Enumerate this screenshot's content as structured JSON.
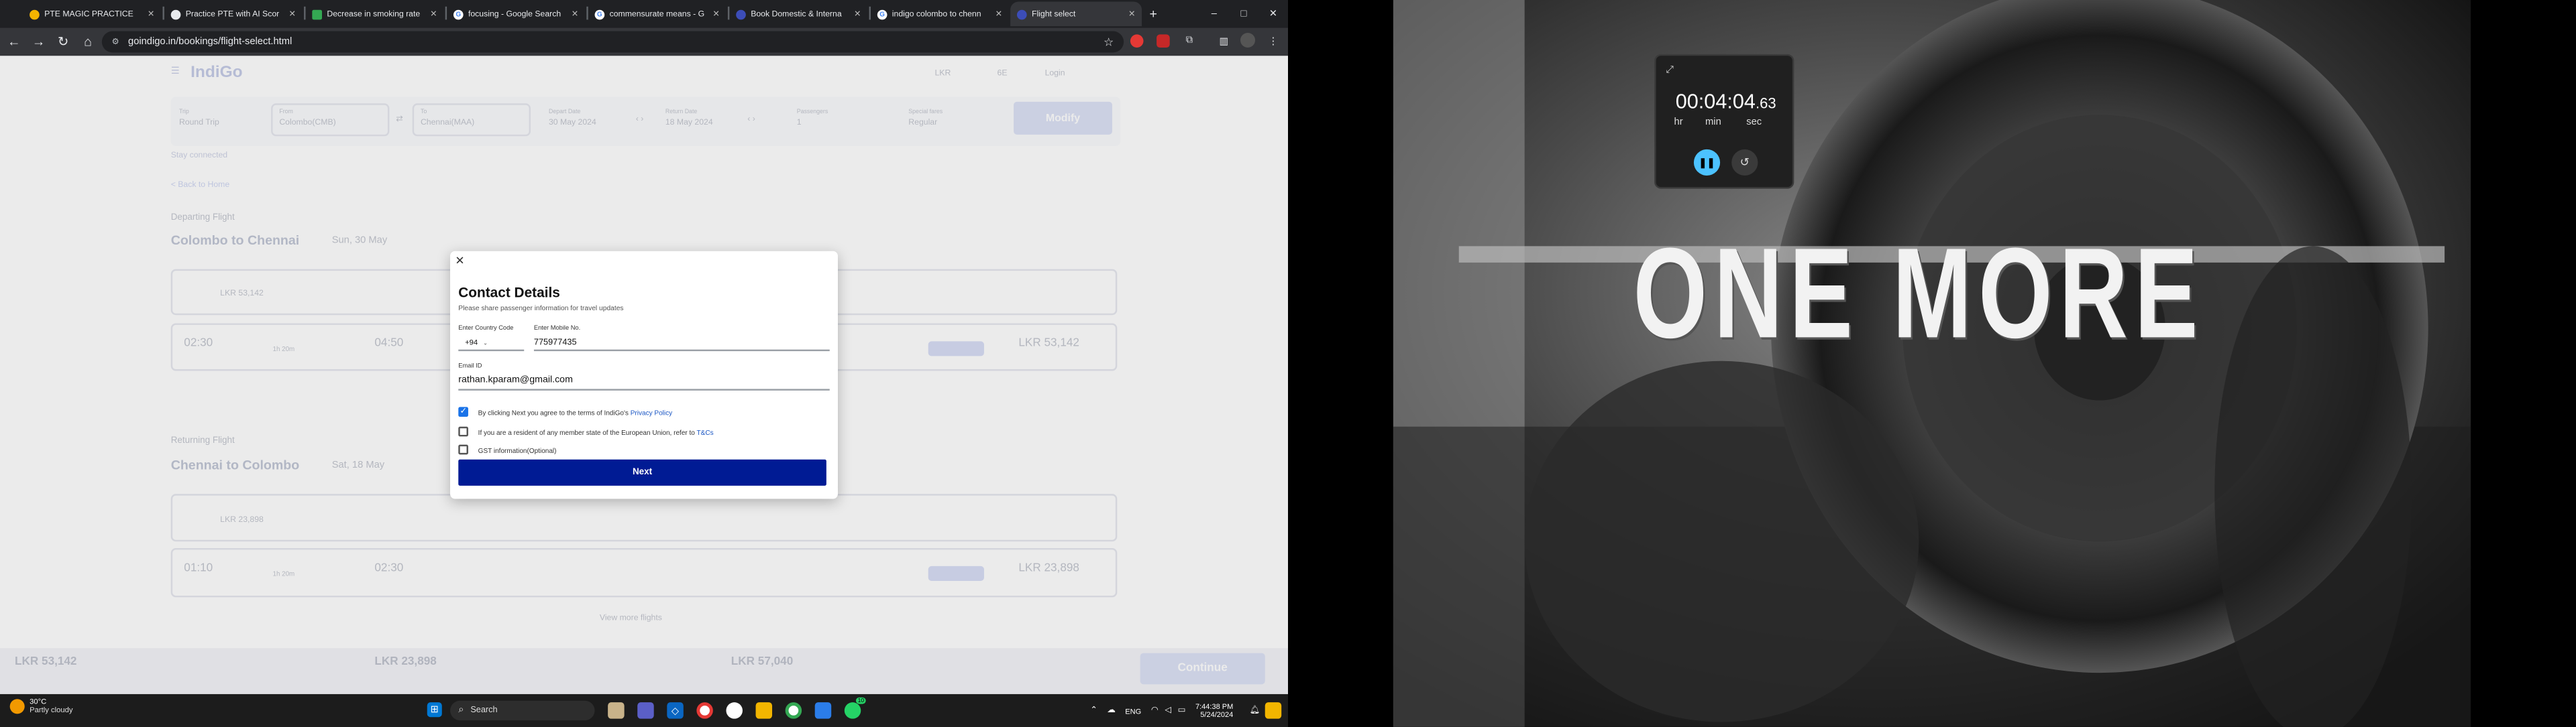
{
  "browser": {
    "tabs": [
      {
        "title": "PTE MAGIC PRACTICE",
        "color": "#f5b400"
      },
      {
        "title": "Practice PTE with AI Scor",
        "color": "#e8eaed"
      },
      {
        "title": "Decrease in smoking rate",
        "color": "#34a853"
      },
      {
        "title": "focusing - Google Search",
        "color": "#e8eaed"
      },
      {
        "title": "commensurate means - G",
        "color": "#e8eaed"
      },
      {
        "title": "Book Domestic & Interna",
        "color": "#3c4db8"
      },
      {
        "title": "indigo colombo to chenn",
        "color": "#e8eaed"
      },
      {
        "title": "Flight select",
        "color": "#3c4db8"
      }
    ],
    "new_tab": "+",
    "url": "goindigo.in/bookings/flight-select.html",
    "window_controls": [
      "–",
      "□",
      "✕"
    ]
  },
  "page": {
    "logo": "IndiGo",
    "nav": [
      "6E",
      "Login"
    ],
    "currency": "LKR",
    "search": {
      "trip_label": "Trip",
      "trip_value": "Round Trip",
      "from_label": "From",
      "from_value": "Colombo(CMB)",
      "to_label": "To",
      "to_value": "Chennai(MAA)",
      "depart_label": "Depart Date",
      "depart_value": "30 May 2024",
      "return_label": "Return Date",
      "return_value": "18 May 2024",
      "pax_label": "Passengers",
      "pax_value": "1",
      "fare_label": "Special fares",
      "fare_value": "Regular",
      "modify_button": "Modify"
    },
    "status_banner": "Stay connected",
    "back_link": "< Back to Home",
    "departing_label": "Departing Flight",
    "route1": "Colombo to Chennai",
    "date1": "Sun, 30 May",
    "route2": "Chennai to Colombo",
    "date2": "Sat, 18 May",
    "returning_label": "Returning Flight",
    "fare1_a": "LKR 53,142",
    "fare1_b": "LKR 53,142",
    "fare2_a": "LKR 23,898",
    "fare2_b": "LKR 23,898",
    "time1_dep": "02:30",
    "time1_arr": "04:50",
    "time2_dep": "01:10",
    "time2_arr": "02:30",
    "duration": "1h 20m",
    "more_flights": "View more flights",
    "bottom_total1": "LKR 53,142",
    "bottom_total2": "LKR 23,898",
    "bottom_total3": "LKR 57,040",
    "continue_button": "Continue"
  },
  "modal": {
    "close": "✕",
    "title": "Contact Details",
    "subtitle": "Please share passenger information for travel updates",
    "country_code_label": "Enter Country Code",
    "country_code_value": "+94",
    "mobile_label": "Enter Mobile No.",
    "mobile_value": "775977435",
    "email_label": "Email ID",
    "email_value": "rathan.kparam@gmail.com",
    "consent_text": "By clicking Next you agree to the terms of IndiGo's",
    "consent_link": "Privacy Policy",
    "eu_text": "If you are a resident of any member state of the European Union, refer to",
    "eu_link": "T&Cs",
    "gst_text": "GST information(Optional)",
    "next_button": "Next"
  },
  "taskbar": {
    "weather_temp": "30°C",
    "weather_desc": "Partly cloudy",
    "search_placeholder": "Search",
    "lang": "ENG",
    "time": "7:44:38 PM",
    "date": "5/24/2024",
    "whatsapp_badge": "10"
  },
  "wallpaper": {
    "motto": "ONE MORE"
  },
  "timer": {
    "hours": "00",
    "minutes": "04",
    "seconds": "04",
    "fraction": ".63",
    "unit_hr": "hr",
    "unit_min": "min",
    "unit_sec": "sec"
  }
}
